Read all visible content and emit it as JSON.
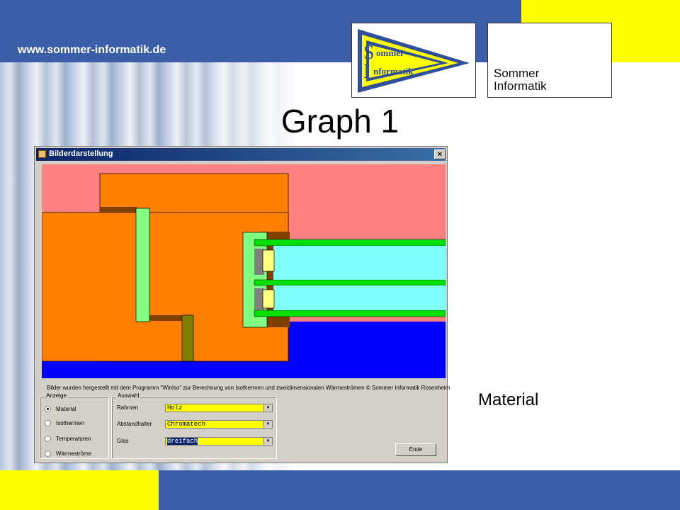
{
  "site": {
    "url": "www.sommer-informatik.de"
  },
  "logo_pennant": {
    "line1": "ommer",
    "line2": "nformatik",
    "cap1": "S",
    "cap2": "I"
  },
  "logo_text": {
    "line1": "Sommer",
    "line2": "Informatik"
  },
  "slide": {
    "title": "Graph 1",
    "caption": "Material"
  },
  "colors": {
    "accent_blue": "#3a5ea8",
    "accent_yellow": "#ffff00"
  },
  "window": {
    "title": "Bilderdarstellung",
    "close_label": "×",
    "footer_note": "Bilder wurden hergestellt mit dem Programm \"Winlso\" zur Berechnung von Isothermen und zweidimensionalen Wärmeströmen © Sommer Informatik Rosenheim",
    "anzeige": {
      "label": "Anzeige",
      "options": [
        {
          "label": "Material",
          "selected": true
        },
        {
          "label": "Isothermen",
          "selected": false
        },
        {
          "label": "Temperaturen",
          "selected": false
        },
        {
          "label": "Wärmeströme",
          "selected": false
        }
      ]
    },
    "auswahl": {
      "label": "Auswahl",
      "fields": [
        {
          "label": "Rahmen",
          "value": "Holz"
        },
        {
          "label": "Abstandhalter",
          "value": "Chromatech"
        },
        {
          "label": "Glas",
          "value": "dreifach"
        }
      ]
    },
    "ende_label": "Ende"
  }
}
